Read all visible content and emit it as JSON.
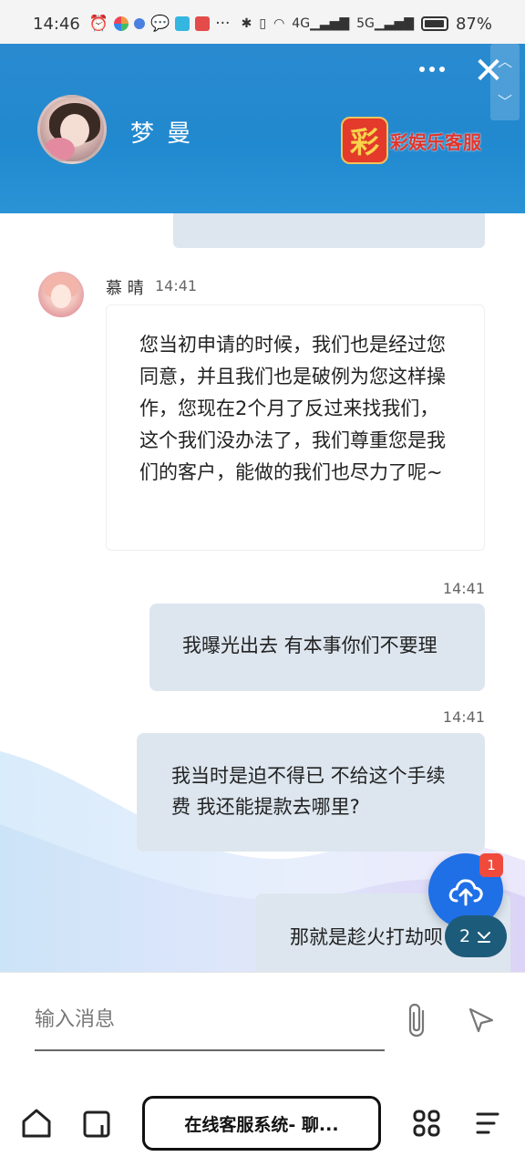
{
  "status_bar": {
    "time": "14:46",
    "network_4g": "4G",
    "network_5g": "5G",
    "battery": "87%",
    "battery_level": 0.87
  },
  "header": {
    "contact_name": "梦 曼",
    "brand_logo_char": "彩",
    "brand_name": "彩娱乐客服",
    "close_glyph": "✕"
  },
  "messages": [
    {
      "from": "agent",
      "name": "慕 晴",
      "time": "14:41",
      "text": "您当初申请的时候，我们也是经过您同意，并且我们也是破例为您这样操作，您现在2个月了反过来找我们，这个我们没办法了，我们尊重您是我们的客户，能做的我们也尽力了呢~"
    },
    {
      "from": "me",
      "time": "14:41",
      "text": "我曝光出去 有本事你们不要理"
    },
    {
      "from": "me",
      "time": "14:41",
      "text": "我当时是迫不得已 不给这个手续费 我还能提款去哪里?"
    },
    {
      "from": "me",
      "time": "",
      "text": "那就是趁火打劫呗"
    }
  ],
  "fab": {
    "badge": "1",
    "unread_count": "2"
  },
  "input": {
    "placeholder": "输入消息"
  },
  "browser": {
    "tab_title": "在线客服系统- 聊..."
  },
  "colors": {
    "header_blue": "#2189cf",
    "my_bubble": "#dde6ef",
    "fab_blue": "#1f6fe6",
    "badge_red": "#f04a3c"
  }
}
